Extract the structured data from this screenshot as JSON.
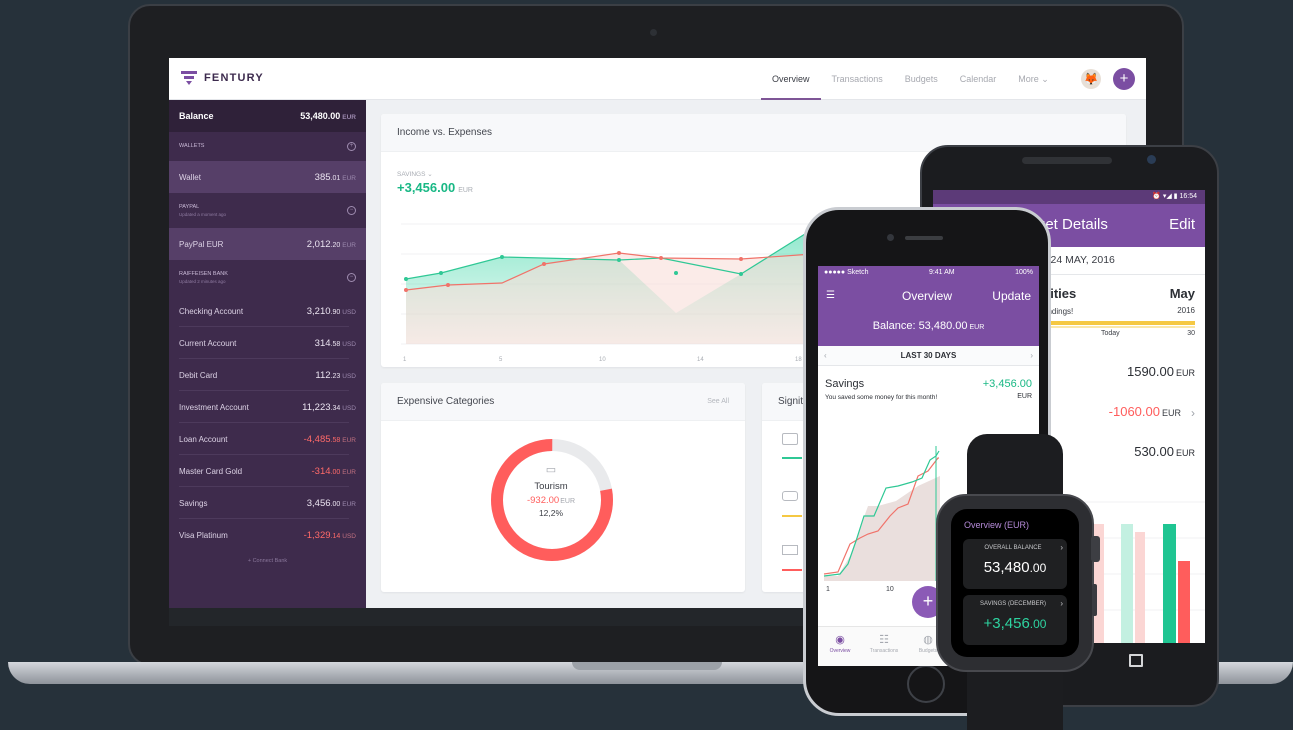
{
  "laptop": {
    "brand": "FENTURY",
    "nav": [
      "Overview",
      "Transactions",
      "Budgets",
      "Calendar",
      "More"
    ],
    "sidebar": {
      "balance": {
        "label": "Balance",
        "amount": "53,480.00",
        "currency": "EUR"
      },
      "groups": [
        {
          "name": "WALLETS",
          "sub": ""
        },
        {
          "name": "PAYPAL",
          "sub": "Updated a moment ago"
        },
        {
          "name": "RAIFFEISEN BANK",
          "sub": "Updated 2 minutes ago"
        }
      ],
      "accounts": [
        {
          "label": "Wallet",
          "int": "385",
          "dec": ".01",
          "currency": "EUR"
        },
        {
          "label": "PayPal EUR",
          "int": "2,012",
          "dec": ".20",
          "currency": "EUR"
        },
        {
          "label": "Checking Account",
          "int": "3,210",
          "dec": ".90",
          "currency": "USD"
        },
        {
          "label": "Current Account",
          "int": "314",
          "dec": ".58",
          "currency": "USD"
        },
        {
          "label": "Debit Card",
          "int": "112",
          "dec": ".23",
          "currency": "USD"
        },
        {
          "label": "Investment Account",
          "int": "11,223",
          "dec": ".34",
          "currency": "USD"
        },
        {
          "label": "Loan Account",
          "int": "-4,485",
          "dec": ".58",
          "currency": "EUR"
        },
        {
          "label": "Master Card Gold",
          "int": "-314",
          "dec": ".00",
          "currency": "EUR"
        },
        {
          "label": "Savings",
          "int": "3,456",
          "dec": ".00",
          "currency": "EUR"
        },
        {
          "label": "Visa Platinum",
          "int": "-1,329",
          "dec": ".14",
          "currency": "USD"
        }
      ],
      "connect": "+ Connect Bank"
    },
    "income_card": {
      "title": "Income vs. Expenses",
      "savings_label": "SAVINGS",
      "savings_value": "+3,456.00",
      "currency": "EUR",
      "x_ticks": [
        "1",
        "5",
        "10",
        "14",
        "18"
      ]
    },
    "categories_card": {
      "title": "Expensive Categories",
      "link": "See All",
      "category": "Tourism",
      "amount": "-932.00",
      "currency": "EUR",
      "percent": "12,2%",
      "share": 0.78
    },
    "significant_card": {
      "title": "Signit"
    }
  },
  "android": {
    "time": "16:54",
    "title": "get Details",
    "edit": "Edit",
    "date": "Y, 24 MAY, 2016",
    "budget_title": "ilities",
    "month": "May",
    "year": "2016",
    "sub": "endings!",
    "today": "Today",
    "day_end": "30",
    "values": [
      {
        "amount": "1590.00",
        "currency": "EUR",
        "negative": false
      },
      {
        "amount": "-1060.00",
        "currency": "EUR",
        "negative": true
      },
      {
        "amount": "530.00",
        "currency": "EUR",
        "negative": false
      }
    ]
  },
  "iphone": {
    "carrier": "●●●●● Sketch",
    "time": "9:41 AM",
    "battery": "100%",
    "title": "Overview",
    "update": "Update",
    "balance_label": "Balance: 53,480.00",
    "balance_currency": "EUR",
    "range": "LAST 30 DAYS",
    "savings_title": "Savings",
    "savings_sub": "You saved some money for this month!",
    "savings_value": "+3,456.00",
    "savings_currency": "EUR",
    "axis": [
      "1",
      "10"
    ],
    "tabs": [
      "Overview",
      "Transactions",
      "Budgets"
    ]
  },
  "watch": {
    "title": "Overview (EUR)",
    "cards": [
      {
        "label": "OVERALL BALANCE",
        "int": "53,480",
        "dec": ".00"
      },
      {
        "label": "SAVINGS (DECEMBER)",
        "int": "+3,456",
        "dec": ".00"
      }
    ]
  },
  "colors": {
    "accent": "#7b4ea2",
    "positive": "#19b885",
    "negative": "#ff5d5c",
    "sidebar": "#3e2b4c"
  }
}
